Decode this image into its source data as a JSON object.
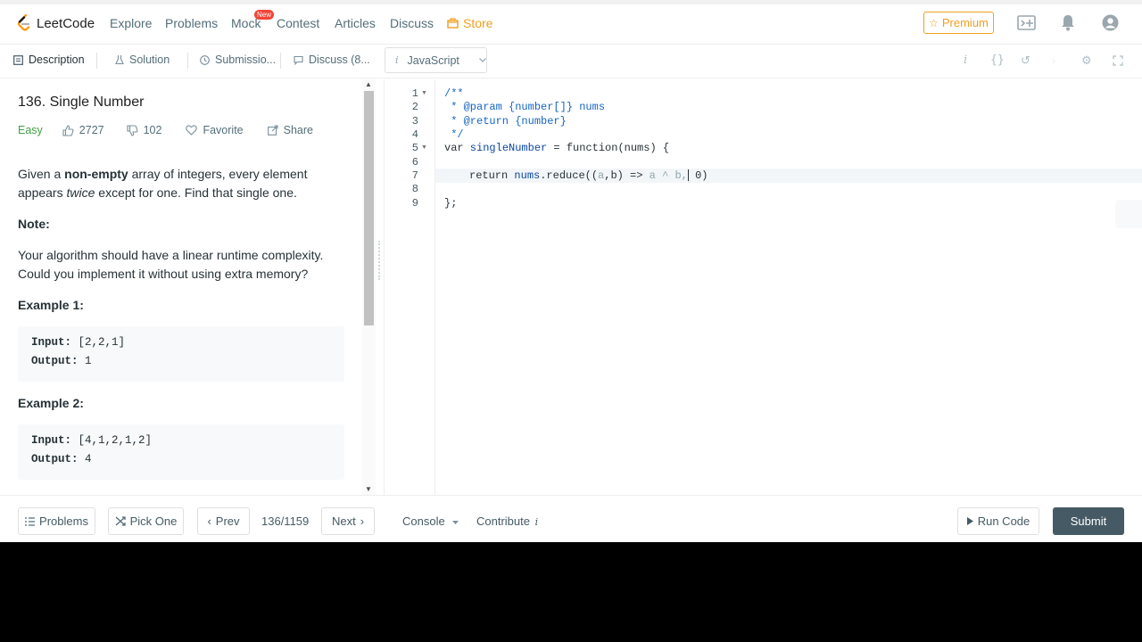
{
  "navbar": {
    "logo_text": "LeetCode",
    "links": [
      "Explore",
      "Problems",
      "Mock",
      "Contest",
      "Articles",
      "Discuss"
    ],
    "new_badge": "New",
    "store_label": "Store",
    "premium_label": "Premium",
    "accent_color": "#f0a020"
  },
  "tabs": {
    "description": "Description",
    "solution": "Solution",
    "submissions": "Submissio...",
    "discuss": "Discuss (8...",
    "language": "JavaScript"
  },
  "problem": {
    "title": "136. Single Number",
    "difficulty": "Easy",
    "likes": "2727",
    "dislikes": "102",
    "favorite_label": "Favorite",
    "share_label": "Share",
    "desc_p1_a": "Given a ",
    "desc_p1_b": "non-empty",
    "desc_p1_c": " array of integers, every element appears ",
    "desc_p1_d": "twice",
    "desc_p1_e": " except for one. Find that single one.",
    "note_heading": "Note:",
    "note_text": "Your algorithm should have a linear runtime complexity. Could you implement it without using extra memory?",
    "example1_heading": "Example 1:",
    "example1_input_label": "Input:",
    "example1_input": " [2,2,1]",
    "example1_output_label": "Output:",
    "example1_output": " 1",
    "example2_heading": "Example 2:",
    "example2_input_label": "Input:",
    "example2_input": " [4,1,2,1,2]",
    "example2_output_label": "Output:",
    "example2_output": " 4"
  },
  "editor": {
    "line_numbers": [
      "1",
      "2",
      "3",
      "4",
      "5",
      "6",
      "7",
      "8",
      "9"
    ],
    "lines": {
      "l1": "/**",
      "l2": " * @param {number[]} nums",
      "l3": " * @return {number}",
      "l4": " */",
      "l5_kw": "var",
      "l5_name": " singleNumber",
      "l5_rest": " = function(nums) {",
      "l7_kw": "return",
      "l7_a": " nums",
      "l7_b": ".reduce((",
      "l7_c": "a",
      "l7_d": ",b) => ",
      "l7_e": "a ^ b,",
      "l7_f": " 0)",
      "l9": "};"
    }
  },
  "footer": {
    "problems_label": "Problems",
    "pick_one_label": "Pick One",
    "prev_label": "Prev",
    "page_counter": "136/1159",
    "next_label": "Next",
    "console_label": "Console",
    "contribute_label": "Contribute",
    "run_code_label": "Run Code",
    "submit_label": "Submit",
    "submit_color": "#455a64"
  }
}
